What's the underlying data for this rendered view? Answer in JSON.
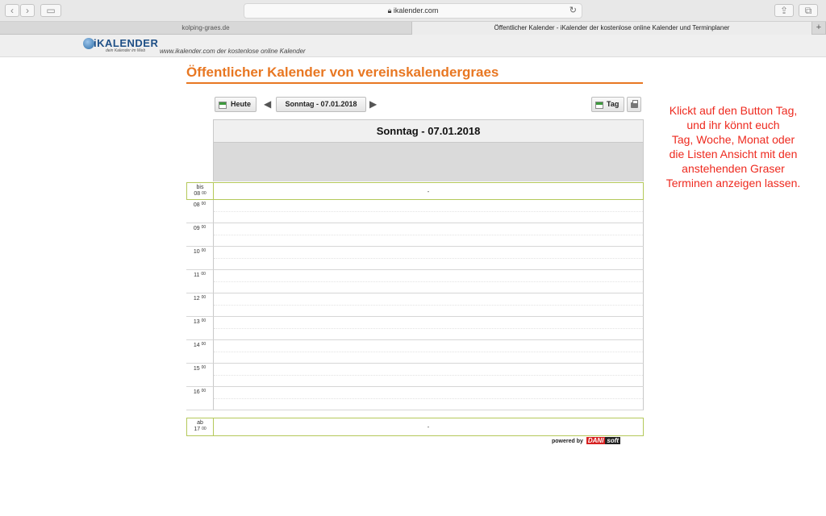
{
  "browser": {
    "address": "ikalender.com",
    "tabs": [
      {
        "label": "kolping-graes.de",
        "active": false
      },
      {
        "label": "Öffentlicher Kalender - iKalender der kostenlose online Kalender und Terminplaner",
        "active": true
      }
    ],
    "new_tab": "+"
  },
  "site": {
    "logo_text": "iKALENDER",
    "logo_tagline": "dein Kalender im Web",
    "url_text": "www.ikalender.com der kostenlose online Kalender"
  },
  "page": {
    "title": "Öffentlicher Kalender von vereinskalendergraes"
  },
  "nav": {
    "today_label": "Heute",
    "date_label": "Sonntag - 07.01.2018",
    "view_label": "Tag"
  },
  "day": {
    "header": "Sonntag - 07.01.2018",
    "before": {
      "top": "bis",
      "hour": "08",
      "min": "00",
      "text": "-"
    },
    "hours": [
      {
        "hour": "08",
        "min": "00"
      },
      {
        "hour": "09",
        "min": "00"
      },
      {
        "hour": "10",
        "min": "00"
      },
      {
        "hour": "11",
        "min": "00"
      },
      {
        "hour": "12",
        "min": "00"
      },
      {
        "hour": "13",
        "min": "00"
      },
      {
        "hour": "14",
        "min": "00"
      },
      {
        "hour": "15",
        "min": "00"
      },
      {
        "hour": "16",
        "min": "00"
      }
    ],
    "after": {
      "top": "ab",
      "hour": "17",
      "min": "00",
      "text": "-"
    }
  },
  "footer": {
    "powered_by": "powered by",
    "brand_a": "DANI",
    "brand_b": "soft"
  },
  "annotation": {
    "lines": [
      "Klickt auf den Button Tag,",
      "und ihr könnt euch",
      "Tag, Woche, Monat oder",
      "die Listen Ansicht mit den",
      "anstehenden Graser",
      "Terminen anzeigen lassen."
    ],
    "color": "#ee2a1f"
  },
  "colors": {
    "accent": "#e87722",
    "row_border": "#b4c85a"
  }
}
